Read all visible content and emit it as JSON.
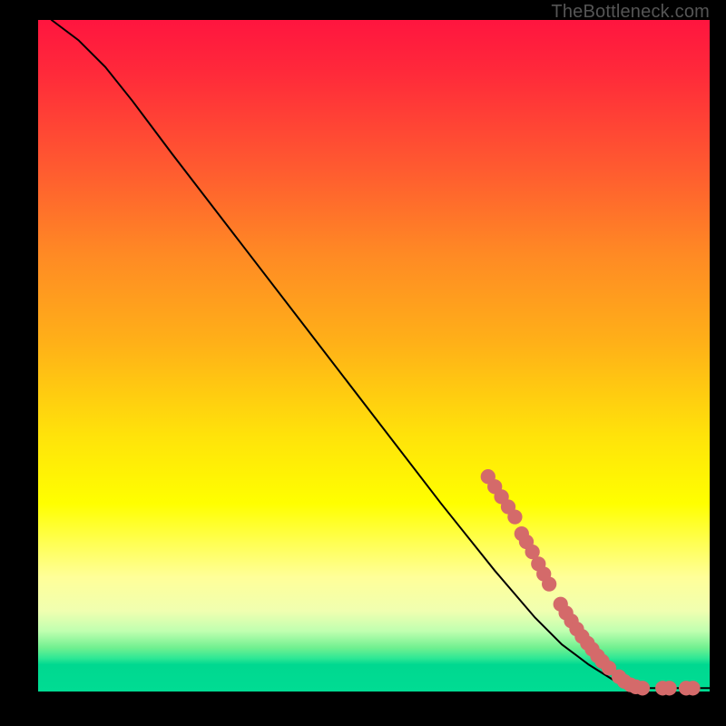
{
  "watermark": "TheBottleneck.com",
  "colors": {
    "marker": "#d46a6a",
    "curve": "#000000",
    "background_frame": "#000000"
  },
  "chart_data": {
    "type": "line",
    "title": "",
    "xlabel": "",
    "ylabel": "",
    "xlim": [
      0,
      100
    ],
    "ylim": [
      0,
      100
    ],
    "grid": false,
    "legend": false,
    "note": "Axes are unlabeled in the image; values below are in percentage of plot width/height, read from pixel positions.",
    "curve_points": [
      {
        "x": 2,
        "y": 100
      },
      {
        "x": 6,
        "y": 97
      },
      {
        "x": 10,
        "y": 93
      },
      {
        "x": 14,
        "y": 88
      },
      {
        "x": 20,
        "y": 80
      },
      {
        "x": 30,
        "y": 67
      },
      {
        "x": 40,
        "y": 54
      },
      {
        "x": 50,
        "y": 41
      },
      {
        "x": 60,
        "y": 28
      },
      {
        "x": 68,
        "y": 18
      },
      {
        "x": 74,
        "y": 11
      },
      {
        "x": 78,
        "y": 7
      },
      {
        "x": 82,
        "y": 4
      },
      {
        "x": 86,
        "y": 1.5
      },
      {
        "x": 90,
        "y": 0.5
      },
      {
        "x": 100,
        "y": 0.5
      }
    ],
    "series": [
      {
        "name": "highlighted-points",
        "style": "scatter",
        "color": "#d46a6a",
        "points": [
          {
            "x": 67,
            "y": 32
          },
          {
            "x": 68,
            "y": 30.5
          },
          {
            "x": 69,
            "y": 29
          },
          {
            "x": 70,
            "y": 27.5
          },
          {
            "x": 71,
            "y": 26
          },
          {
            "x": 72,
            "y": 23.5
          },
          {
            "x": 72.7,
            "y": 22.3
          },
          {
            "x": 73.6,
            "y": 20.8
          },
          {
            "x": 74.5,
            "y": 19
          },
          {
            "x": 75.3,
            "y": 17.5
          },
          {
            "x": 76.1,
            "y": 16
          },
          {
            "x": 77.8,
            "y": 13
          },
          {
            "x": 78.6,
            "y": 11.7
          },
          {
            "x": 79.4,
            "y": 10.5
          },
          {
            "x": 80.2,
            "y": 9.3
          },
          {
            "x": 81,
            "y": 8.2
          },
          {
            "x": 81.8,
            "y": 7.2
          },
          {
            "x": 82.5,
            "y": 6.3
          },
          {
            "x": 83.3,
            "y": 5.3
          },
          {
            "x": 84,
            "y": 4.5
          },
          {
            "x": 85,
            "y": 3.5
          },
          {
            "x": 86.5,
            "y": 2.2
          },
          {
            "x": 87.3,
            "y": 1.5
          },
          {
            "x": 88.2,
            "y": 1
          },
          {
            "x": 89,
            "y": 0.7
          },
          {
            "x": 90,
            "y": 0.5
          },
          {
            "x": 93,
            "y": 0.5
          },
          {
            "x": 94,
            "y": 0.5
          },
          {
            "x": 96.5,
            "y": 0.5
          },
          {
            "x": 97.5,
            "y": 0.5
          }
        ]
      }
    ]
  }
}
